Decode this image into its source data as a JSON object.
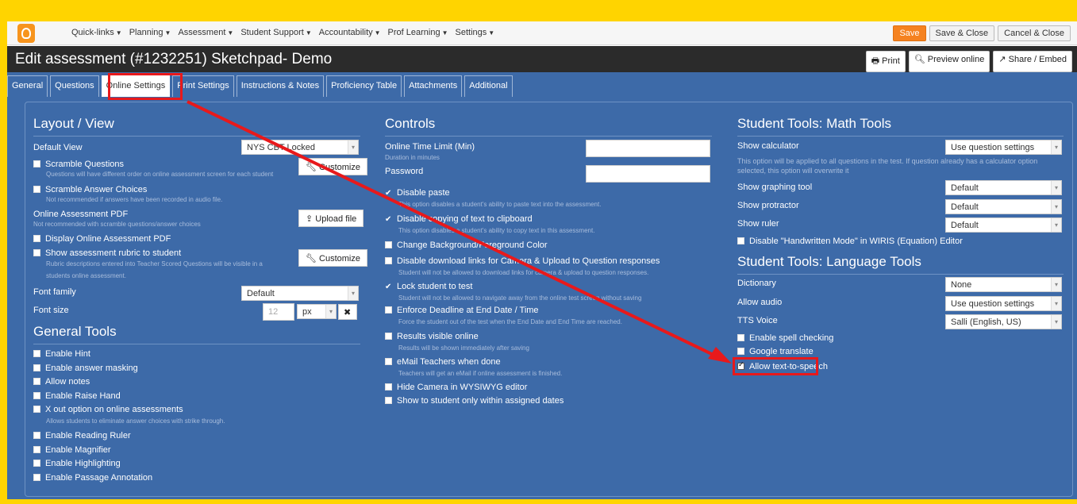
{
  "navbar": {
    "menu": [
      "Quick-links",
      "Planning",
      "Assessment",
      "Student Support",
      "Accountability",
      "Prof Learning",
      "Settings"
    ],
    "buttons": {
      "save": "Save",
      "save_close": "Save & Close",
      "cancel_close": "Cancel & Close"
    }
  },
  "header": {
    "title": "Edit assessment (#1232251) Sketchpad- Demo",
    "print": "Print",
    "preview": "Preview online",
    "share": "Share / Embed"
  },
  "tabs": [
    "General",
    "Questions",
    "Online Settings",
    "Print Settings",
    "Instructions & Notes",
    "Proficiency Table",
    "Attachments",
    "Additional"
  ],
  "layout": {
    "title": "Layout / View",
    "default_view_label": "Default View",
    "default_view_value": "NYS CBT Locked",
    "scramble_q": "Scramble Questions",
    "scramble_q_hint": "Questions will have different order on online assessment screen for each student",
    "customize": "Customize",
    "scramble_a": "Scramble Answer Choices",
    "scramble_a_hint": "Not recommended if answers have been recorded in audio file.",
    "pdf_label": "Online Assessment PDF",
    "pdf_hint": "Not recommended with scramble questions/answer choices",
    "upload": "Upload file",
    "display_pdf": "Display Online Assessment PDF",
    "rubric": "Show assessment rubric to student",
    "rubric_hint1": "Rubric descriptions entered into Teacher Scored Questions will be visible in a",
    "rubric_hint2": "students online assessment.",
    "font_family_label": "Font family",
    "font_family_value": "Default",
    "font_size_label": "Font size",
    "font_size_value": "12",
    "font_unit": "px"
  },
  "general_tools": {
    "title": "General Tools",
    "items": [
      "Enable Hint",
      "Enable answer masking",
      "Allow notes",
      "Enable Raise Hand",
      "X out option on online assessments"
    ],
    "xout_hint": "Allows students to eliminate answer choices with strike through.",
    "items2": [
      "Enable Reading Ruler",
      "Enable Magnifier",
      "Enable Highlighting",
      "Enable Passage Annotation"
    ]
  },
  "controls": {
    "title": "Controls",
    "time_limit": "Online Time Limit (Min)",
    "time_hint": "Duration in minutes",
    "password": "Password",
    "disable_paste": "Disable paste",
    "disable_paste_hint": "This option disables a student's ability to paste text into the assessment.",
    "disable_copy": "Disable copying of text to clipboard",
    "disable_copy_hint": "This option disables a student's ability to copy text in this assessment.",
    "change_bg": "Change Background/Foreground Color",
    "disable_download": "Disable download links for Camera & Upload to Question responses",
    "disable_download_hint": "Student will not be allowed to download links for camera & upload to question responses.",
    "lock": "Lock student to test",
    "lock_hint": "Student will not be allowed to navigate away from the online test screen without saving",
    "deadline": "Enforce Deadline at End Date / Time",
    "deadline_hint": "Force the student out of the test when the End Date and End Time are reached.",
    "results": "Results visible online",
    "results_hint": "Results will be shown immediately after saving",
    "email": "eMail Teachers when done",
    "email_hint": "Teachers will get an eMail if online assessment is finished.",
    "hide_camera": "Hide Camera in WYSIWYG editor",
    "show_dates": "Show to student only within assigned dates"
  },
  "math_tools": {
    "title": "Student Tools: Math Tools",
    "calc_label": "Show calculator",
    "calc_value": "Use question settings",
    "calc_hint": "This option will be applied to all questions in the test. If question already has a calculator option selected, this option will overwrite it",
    "graphing_label": "Show graphing tool",
    "graphing_value": "Default",
    "protractor_label": "Show protractor",
    "protractor_value": "Default",
    "ruler_label": "Show ruler",
    "ruler_value": "Default",
    "wiris": "Disable \"Handwritten Mode\" in WIRIS (Equation) Editor"
  },
  "lang_tools": {
    "title": "Student Tools: Language Tools",
    "dict_label": "Dictionary",
    "dict_value": "None",
    "audio_label": "Allow audio",
    "audio_value": "Use question settings",
    "tts_label": "TTS Voice",
    "tts_value": "Salli (English, US)",
    "spell": "Enable spell checking",
    "translate": "Google translate",
    "allow_tts": "Allow text-to-speech"
  },
  "colors": {
    "frame": "#ffd400",
    "panel": "#3d6aa8",
    "header": "#2b2b2b",
    "annotation": "#e8191b",
    "save": "#f58220"
  }
}
